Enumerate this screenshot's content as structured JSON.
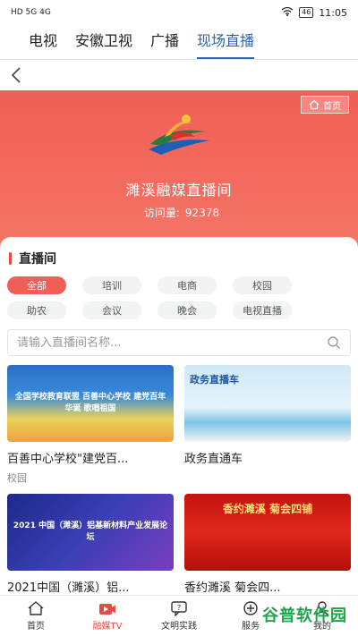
{
  "status": {
    "left": "HD 5G 4G",
    "time": "11:05",
    "battery": "46"
  },
  "channel_tabs": [
    "电视",
    "安徽卫视",
    "广播",
    "现场直播"
  ],
  "hero": {
    "home_label": "首页",
    "title": "濉溪融媒直播间",
    "visits_label": "访问量:",
    "visits_value": "92378"
  },
  "section": {
    "title": "直播间"
  },
  "categories": [
    "全部",
    "培训",
    "电商",
    "校园",
    "助农",
    "会议",
    "晚会",
    "电视直播"
  ],
  "search": {
    "placeholder": "请输入直播间名称..."
  },
  "items": [
    {
      "title": "百善中心学校\"建党百...",
      "tag": "校园",
      "thumb_text": "全国学校教育联盟 百善中心学校 建党百年华诞 歌唱祖国"
    },
    {
      "title": "政务直通车",
      "tag": "",
      "thumb_text": "政务直播车"
    },
    {
      "title": "2021中国（濉溪）铝...",
      "tag": "",
      "thumb_text": "2021 中国（濉溪）铝基新材料产业发展论坛"
    },
    {
      "title": "香约濉溪 菊会四...",
      "tag": "",
      "thumb_text": "香约濉溪 菊会四铺"
    }
  ],
  "bottom_nav": [
    "首页",
    "融媒TV",
    "文明实践",
    "服务",
    "我的"
  ],
  "watermark": "谷普软件园",
  "colors": {
    "accent_red": "#f05f56",
    "tab_blue": "#2a63b8"
  }
}
